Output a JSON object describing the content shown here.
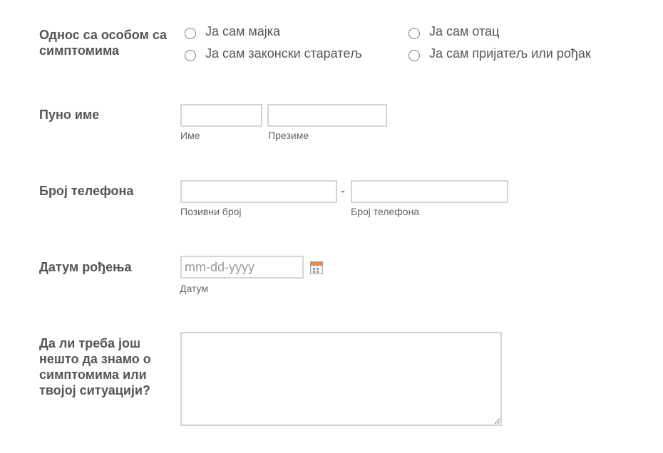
{
  "relationship": {
    "label": "Однос са особом са симптомима",
    "options": [
      {
        "label": "Ја сам мајка"
      },
      {
        "label": "Ја сам отац"
      },
      {
        "label": "Ја сам законски старатељ"
      },
      {
        "label": "Ја сам пријатељ или рођак"
      }
    ]
  },
  "full_name": {
    "label": "Пуно име",
    "first_name": {
      "value": "",
      "sublabel": "Име"
    },
    "last_name": {
      "value": "",
      "sublabel": "Презиме"
    }
  },
  "phone": {
    "label": "Број телефона",
    "area_code": {
      "value": "",
      "sublabel": "Позивни број"
    },
    "separator": "-",
    "number": {
      "value": "",
      "sublabel": "Број телефона"
    }
  },
  "birth_date": {
    "label": "Датум рођења",
    "placeholder": "mm-dd-yyyy",
    "sublabel": "Датум",
    "icon": "calendar-icon"
  },
  "extra_info": {
    "label": "Да ли треба још нешто да знамо о симптомима или твојој ситуацији?",
    "value": ""
  }
}
